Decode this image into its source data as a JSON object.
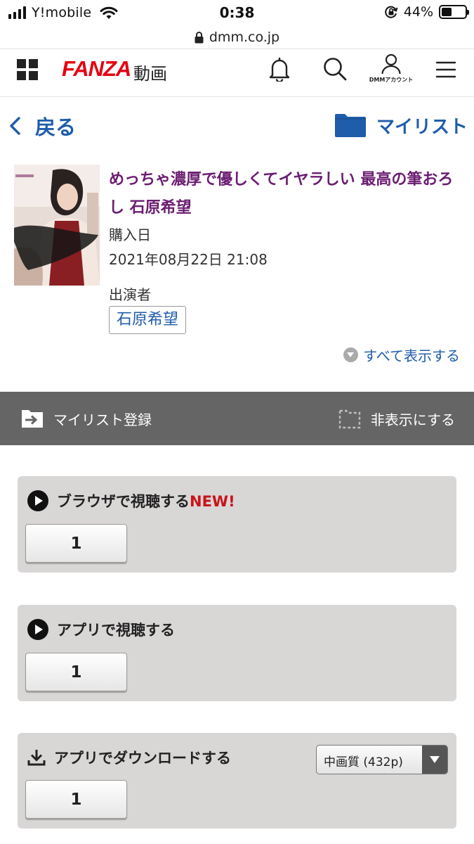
{
  "status_bar": {
    "carrier": "Y!mobile",
    "time": "0:38",
    "battery_percent": "44%",
    "battery_level": 0.44,
    "url": "dmm.co.jp"
  },
  "header": {
    "logo": "FANZA",
    "logo_sub": "動画",
    "account_label": "DMMアカウント",
    "icons": [
      "grid-menu-icon",
      "bell-icon",
      "search-icon",
      "account-icon",
      "hamburger-menu-icon"
    ]
  },
  "nav": {
    "back_label": "戻る",
    "mylist_label": "マイリスト"
  },
  "product": {
    "title": "めっちゃ濃厚で優しくてイヤラしい 最高の筆おろし 石原希望",
    "purchase_date_label": "購入日",
    "purchase_date": "2021年08月22日 21:08",
    "cast_label": "出演者",
    "cast": [
      "石原希望"
    ],
    "show_all_label": "すべて表示する"
  },
  "action_bar": {
    "mylist_add_label": "マイリスト登録",
    "hide_label": "非表示にする"
  },
  "panels": {
    "browser": {
      "title": "ブラウザで視聴する",
      "badge": "NEW!",
      "parts": [
        "1"
      ]
    },
    "app": {
      "title": "アプリで視聴する",
      "parts": [
        "1"
      ]
    },
    "download": {
      "title": "アプリでダウンロードする",
      "quality": "中画質 (432p)",
      "parts": [
        "1"
      ]
    }
  },
  "colors": {
    "brand_red": "#e60012",
    "link_blue": "#1f5dab",
    "title_purple": "#6b1d72",
    "action_bar_bg": "#656565",
    "panel_bg": "#d9d6d6",
    "new_badge": "#c9131b"
  }
}
